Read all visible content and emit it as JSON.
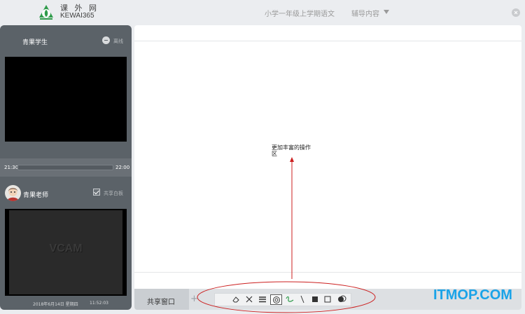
{
  "header": {
    "brand_cn": "课 外 网",
    "brand_en": "KEWAI365",
    "course_title": "小学一年级上学期语文",
    "menu_label": "辅导内容"
  },
  "sidebar": {
    "student_name": "青果学生",
    "offline_label": "离线",
    "time_start": "21:30",
    "time_end": "22:00",
    "progress": 0,
    "teacher_name": "青果老师",
    "share_whiteboard_label": "共享白板",
    "share_whiteboard_checked": true,
    "video_overlay": "VCAM",
    "date": "2018年6月14日 星期四",
    "clock": "11:52:03"
  },
  "main": {
    "annotation": "更加丰富的操作区",
    "share_tab_label": "共享窗口",
    "add_tab_label": "+"
  },
  "toolbar": {
    "tools": [
      "eraser-icon",
      "clear-icon",
      "line-width-icon",
      "color-picker-icon",
      "pen-icon",
      "line-icon",
      "filled-rect-icon",
      "rect-icon",
      "filled-circle-icon",
      "circle-icon"
    ],
    "active_tool": "color-picker-icon"
  },
  "colors": {
    "brand_green": "#2e9b4a",
    "sidebar": "#5b6268",
    "annotation_red": "#cc1f1f",
    "watermark_blue": "#1aa3e8"
  },
  "watermark": "ITMOP.COM"
}
